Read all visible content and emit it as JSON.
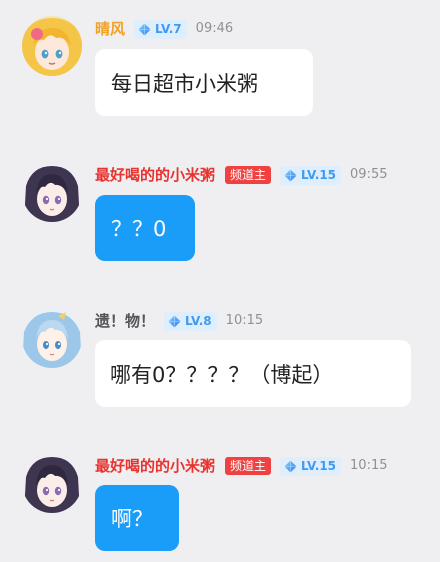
{
  "messages": [
    {
      "name": "晴风",
      "name_color": "#f3a224",
      "owner_tag": "",
      "level": "LV.7",
      "time": "09:46",
      "text": "每日超市小米粥",
      "bubble": "white",
      "avatar_icon": "avatar-blonde-girl"
    },
    {
      "name": "最好喝的的小米粥",
      "name_color": "#e8332f",
      "owner_tag": "频道主",
      "level": "LV.15",
      "time": "09:55",
      "text": "？？0",
      "bubble": "blue",
      "avatar_icon": "avatar-dark-hair-girl"
    },
    {
      "name": "遗！物！",
      "name_color": "#555555",
      "owner_tag": "",
      "level": "LV.8",
      "time": "10:15",
      "text": "哪有0？？？？（博起）",
      "bubble": "white",
      "avatar_icon": "avatar-blue-hair-girl"
    },
    {
      "name": "最好喝的的小米粥",
      "name_color": "#e8332f",
      "owner_tag": "频道主",
      "level": "LV.15",
      "time": "10:15",
      "text": "啊？",
      "bubble": "blue",
      "avatar_icon": "avatar-dark-hair-girl"
    }
  ],
  "colors": {
    "background": "#efeff1",
    "blue_bubble": "#1a9cf9",
    "white_bubble": "#ffffff",
    "owner_tag": "#ef4141",
    "level_text": "#3f9bf2",
    "level_bg": "#dfeefd",
    "time_text": "#8f9096"
  }
}
